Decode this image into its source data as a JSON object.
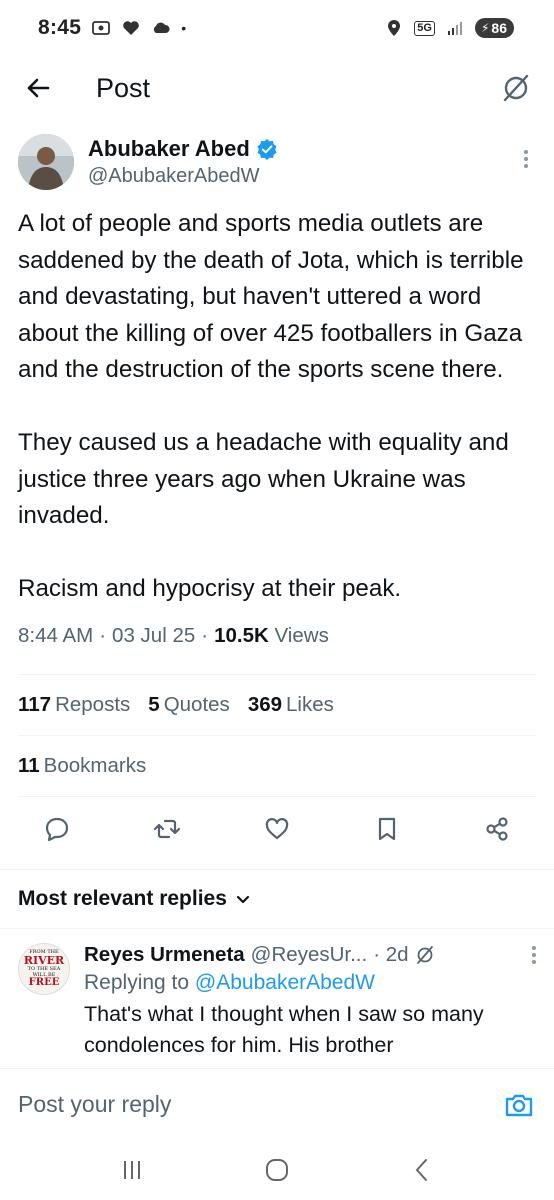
{
  "status_bar": {
    "time": "8:45",
    "battery": "86",
    "network": "5G"
  },
  "nav": {
    "title": "Post"
  },
  "post": {
    "author_name": "Abubaker Abed",
    "author_handle": "@AbubakerAbedW",
    "text": "A lot of people and sports media outlets are saddened by the death of Jota, which is terrible and devastating, but haven't uttered a word about the killing of over 425 footballers in Gaza and the destruction of the sports scene there.\n\nThey caused us a headache with equality and justice three years ago when Ukraine was invaded.\n\nRacism and hypocrisy at their peak.",
    "time": "8:44 AM",
    "date": "03 Jul 25",
    "views_count": "10.5K",
    "views_label": "Views",
    "separator": "·"
  },
  "stats": {
    "reposts_count": "117",
    "reposts_label": "Reposts",
    "quotes_count": "5",
    "quotes_label": "Quotes",
    "likes_count": "369",
    "likes_label": "Likes",
    "bookmarks_count": "11",
    "bookmarks_label": "Bookmarks"
  },
  "replies": {
    "heading": "Most relevant replies",
    "items": [
      {
        "name": "Reyes Urmeneta",
        "handle": "@ReyesUr...",
        "age": "· 2d",
        "replying_prefix": "Replying to",
        "replying_to": "@AbubakerAbedW",
        "text": "That's what I thought when I saw so many condolences for him. His brother",
        "avatar_lines": [
          "FROM THE",
          "RIVER",
          "TO THE SEA",
          "WILL BE",
          "FREE"
        ]
      }
    ]
  },
  "reply_bar": {
    "placeholder": "Post your reply"
  },
  "icons": {
    "back": "arrow-left-icon",
    "grok": "grok-icon",
    "verified": "verified-badge-icon",
    "more": "more-vertical-icon",
    "reply": "comment-icon",
    "repost": "repost-icon",
    "like": "heart-icon",
    "bookmark": "bookmark-icon",
    "share": "share-icon",
    "chevron": "chevron-down-icon",
    "camera": "camera-icon"
  },
  "colors": {
    "accent": "#1d9bf0",
    "text": "#0f1419",
    "secondary": "#536471"
  }
}
